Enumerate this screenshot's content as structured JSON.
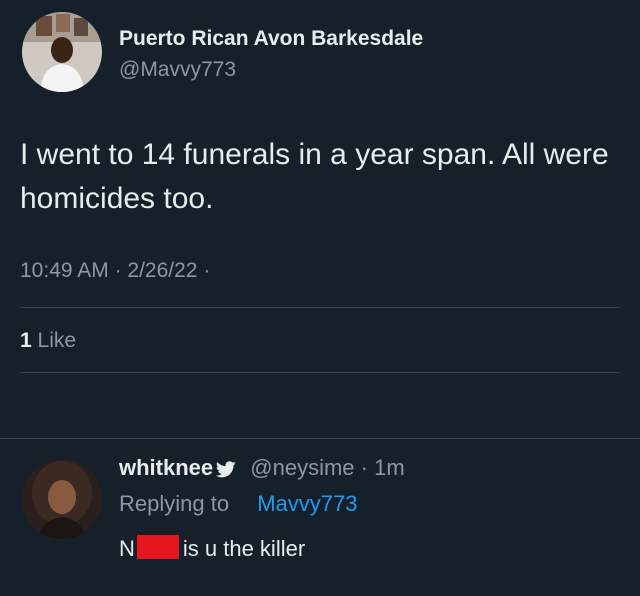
{
  "tweet": {
    "display_name": "Puerto Rican Avon Barkesdale",
    "handle": "@Mavvy773",
    "text": "I went to 14 funerals in a year span. All were homicides too.",
    "time": "10:49 AM",
    "date": "2/26/22",
    "like_count": "1",
    "like_label": "Like"
  },
  "reply": {
    "display_name": "whitknee",
    "handle": "@neysime",
    "age": "1m",
    "replying_to_label": "Replying to",
    "replying_to_user": "Mavvy773",
    "text_prefix": "N",
    "text_suffix": "is u the killer"
  },
  "colors": {
    "background": "#15202b",
    "secondary_text": "#8b98a5",
    "accent": "#1d9bf0",
    "redaction": "#e5161e"
  }
}
